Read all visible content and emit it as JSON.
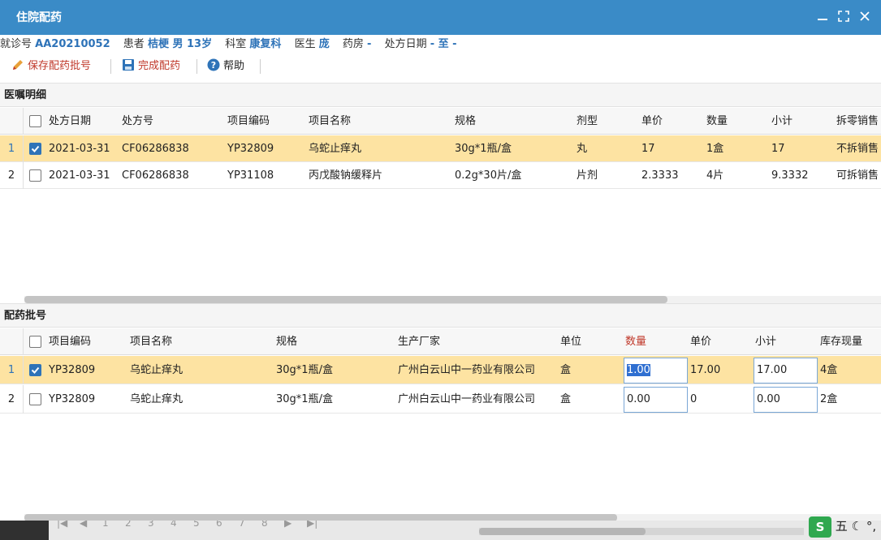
{
  "window": {
    "title": "住院配药"
  },
  "info": {
    "visit_label": "就诊号",
    "visit_value": "AA20210052",
    "patient_label": "患者",
    "patient_value": "桔梗 男 13岁",
    "dept_label": "科室",
    "dept_value": "康复科",
    "doctor_label": "医生",
    "doctor_value": "庞",
    "pharmacy_label": "药房",
    "pharmacy_value": "-",
    "rxdate_label": "处方日期",
    "rxdate_value": "- 至 -"
  },
  "toolbar": {
    "save_batch_label": "保存配药批号",
    "finish_label": "完成配药",
    "help_label": "帮助"
  },
  "orders": {
    "title": "医嘱明细",
    "headers": [
      "处方日期",
      "处方号",
      "项目编码",
      "项目名称",
      "规格",
      "剂型",
      "单价",
      "数量",
      "小计",
      "拆零销售"
    ],
    "rows": [
      {
        "no": "1",
        "checked": true,
        "cells": [
          "2021-03-31",
          "CF06286838",
          "YP32809",
          "乌蛇止痒丸",
          "30g*1瓶/盒",
          "丸",
          "17",
          "1盒",
          "17",
          "不拆销售"
        ]
      },
      {
        "no": "2",
        "checked": false,
        "cells": [
          "2021-03-31",
          "CF06286838",
          "YP31108",
          "丙戊酸钠缓释片",
          "0.2g*30片/盒",
          "片剂",
          "2.3333",
          "4片",
          "9.3332",
          "可拆销售"
        ]
      }
    ]
  },
  "batches": {
    "title": "配药批号",
    "headers": [
      "项目编码",
      "项目名称",
      "规格",
      "生产厂家",
      "单位",
      "数量",
      "单价",
      "小计",
      "库存现量"
    ],
    "rows": [
      {
        "no": "1",
        "checked": true,
        "code": "YP32809",
        "name": "乌蛇止痒丸",
        "spec": "30g*1瓶/盒",
        "maker": "广州白云山中一药业有限公司",
        "unit": "盒",
        "qty": "1.00",
        "price": "17.00",
        "subtotal": "17.00",
        "stock": "4盒"
      },
      {
        "no": "2",
        "checked": false,
        "code": "YP32809",
        "name": "乌蛇止痒丸",
        "spec": "30g*1瓶/盒",
        "maker": "广州白云山中一药业有限公司",
        "unit": "盒",
        "qty": "0.00",
        "price": "0",
        "subtotal": "0.00",
        "stock": "2盒"
      }
    ]
  },
  "pager": {
    "pages": [
      "1",
      "2",
      "3",
      "4",
      "5",
      "6",
      "7",
      "8"
    ]
  },
  "ime": {
    "mode_label": "五"
  },
  "colors": {
    "titlebar": "#3a8bc7",
    "link_blue": "#2e73b8",
    "selected_row": "#fde3a2",
    "required_red": "#c0392b"
  }
}
